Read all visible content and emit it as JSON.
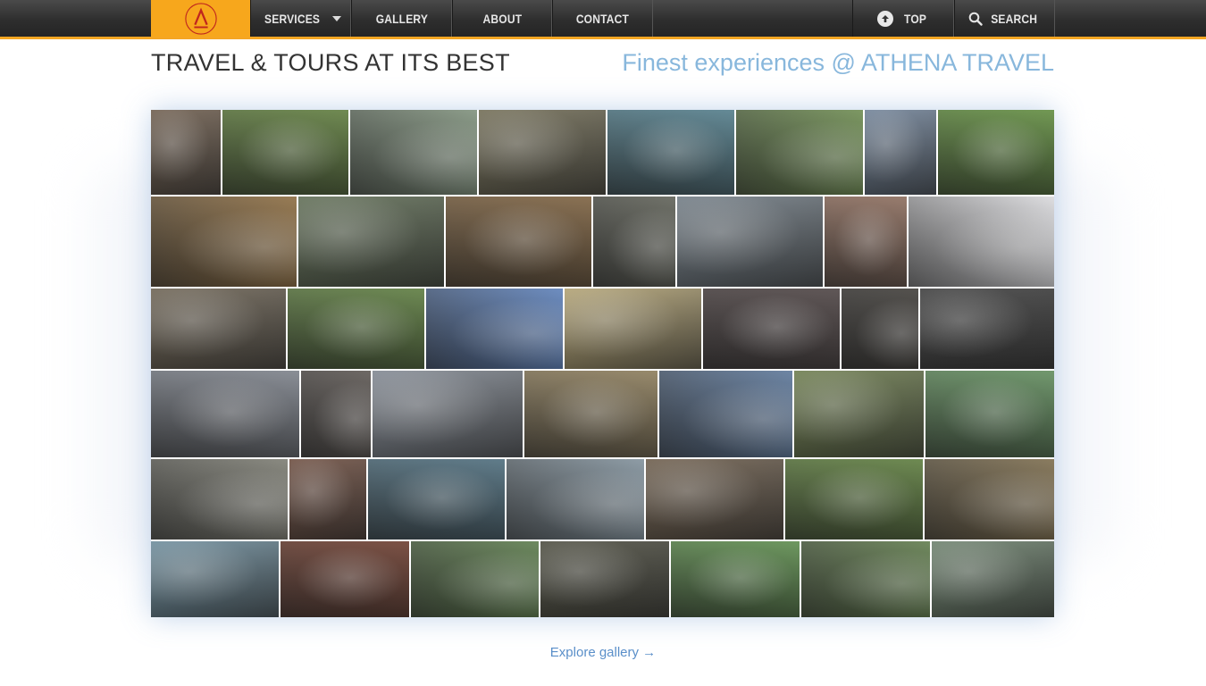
{
  "nav": {
    "logo_alt": "ATHENA",
    "items": [
      {
        "label": "SERVICES",
        "has_dropdown": true
      },
      {
        "label": "GALLERY"
      },
      {
        "label": "ABOUT"
      },
      {
        "label": "CONTACT"
      }
    ],
    "top_label": "TOP",
    "search_label": "SEARCH"
  },
  "heading": {
    "left": "TRAVEL & TOURS AT ITS BEST",
    "right": "Finest experiences @ ATHENA TRAVEL"
  },
  "gallery": {
    "rows": [
      [
        "#6b5a4a",
        "#5c7a3a",
        "#7d8f7a",
        "#6f6a52",
        "#4f7a88",
        "#6b8a4e",
        "#6d7f95",
        "#5e8a3c"
      ],
      [
        "#8a6a3e",
        "#5d6b52",
        "#7a5e3c",
        "#5d5f55",
        "#6f7a83",
        "#8a6a5a",
        "#d9d9dc"
      ],
      [
        "#6a6050",
        "#5a7a3c",
        "#5a7eb8",
        "#b0a070",
        "#4a4040",
        "#3d3a36",
        "#3a3a3a"
      ],
      [
        "#7a7f88",
        "#5a5450",
        "#7f8690",
        "#8a7a58",
        "#5a7598",
        "#6a7a4a",
        "#5e8a5a"
      ],
      [
        "#7a7a70",
        "#6a4a3c",
        "#4a6a7a",
        "#7f8f9a",
        "#6a5a48",
        "#5a7a3a",
        "#7a6a4a"
      ],
      [
        "#6a8a9a",
        "#6a3a2c",
        "#5a7a4a",
        "#4a4a3c",
        "#5a8a4a",
        "#5e7a4a",
        "#6a7f6a"
      ]
    ]
  },
  "footer": {
    "explore_label": "Explore gallery →"
  }
}
